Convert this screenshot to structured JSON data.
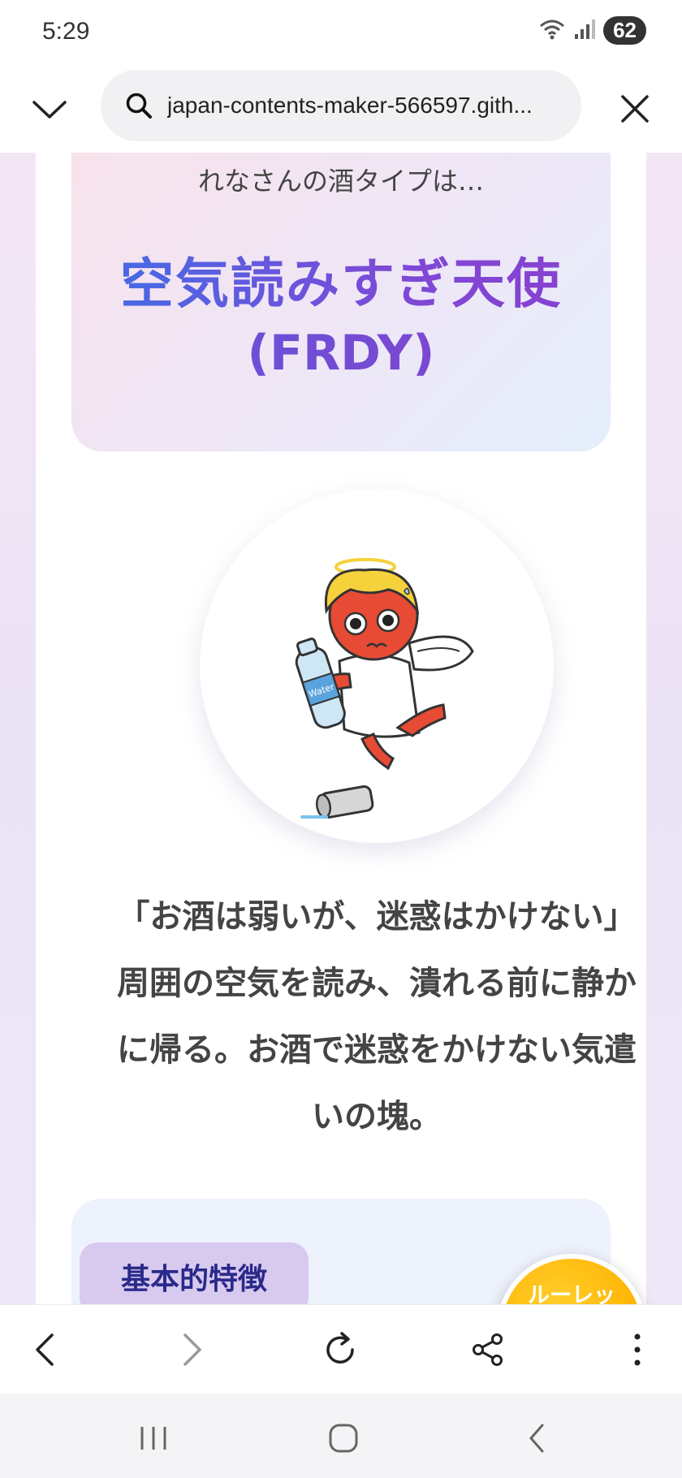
{
  "status": {
    "time": "5:29",
    "battery": "62"
  },
  "browser": {
    "url": "japan-contents-maker-566597.gith..."
  },
  "result": {
    "intro": "れなさんの酒タイプは…",
    "title": "空気読みすぎ天使",
    "code": "(FRDY)",
    "description": "「お酒は弱いが、迷惑はかけない」周囲の空気を読み、潰れる前に静かに帰る。お酒で迷惑をかけない気遣いの塊。"
  },
  "features": {
    "label": "基本的特徴"
  },
  "roulette": {
    "label": "ルーレットで遊ぶ"
  },
  "illustration": {
    "bottle_text": "Water"
  },
  "icons": [
    "wifi-icon",
    "signal-icon",
    "chevron-down-icon",
    "search-icon",
    "close-icon",
    "back-icon",
    "forward-icon",
    "reload-icon",
    "share-icon",
    "more-icon",
    "recent-apps-icon",
    "home-icon",
    "nav-back-icon",
    "dice-icon",
    "angel-illustration"
  ]
}
